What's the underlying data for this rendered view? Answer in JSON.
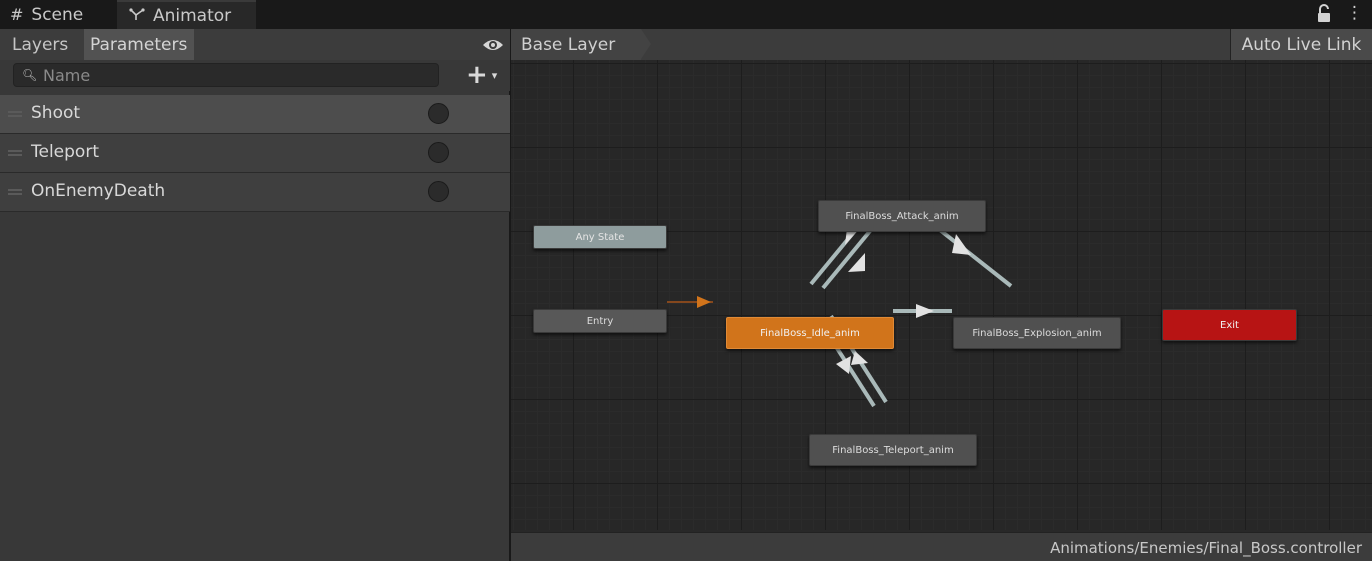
{
  "tabs": {
    "scene": {
      "icon": "grid-icon",
      "label": "Scene"
    },
    "animator": {
      "icon": "animator-icon",
      "label": "Animator"
    }
  },
  "window_menu": {
    "lock": "lock-icon",
    "menu_glyph": "⋮"
  },
  "left_panel": {
    "tabs": {
      "layers": "Layers",
      "parameters": "Parameters"
    },
    "visibility_icon": "eye-icon",
    "search": {
      "placeholder": "Name",
      "value": ""
    },
    "add_button": {
      "plus": "+",
      "caret": "▾"
    },
    "parameters": [
      {
        "name": "Shoot",
        "type": "trigger",
        "selected": true
      },
      {
        "name": "Teleport",
        "type": "trigger",
        "selected": false
      },
      {
        "name": "OnEnemyDeath",
        "type": "trigger",
        "selected": false
      }
    ]
  },
  "graph": {
    "breadcrumb": "Base Layer",
    "auto_live_link": "Auto Live Link",
    "states": {
      "any_state": "Any State",
      "entry": "Entry",
      "exit": "Exit",
      "idle": "FinalBoss_Idle_anim",
      "attack": "FinalBoss_Attack_anim",
      "explosion": "FinalBoss_Explosion_anim",
      "teleport": "FinalBoss_Teleport_anim"
    },
    "transitions": [
      {
        "from": "entry",
        "to": "idle",
        "color": "#c26a1a"
      },
      {
        "from": "idle",
        "to": "attack",
        "color": "#b5c5c5"
      },
      {
        "from": "attack",
        "to": "idle",
        "color": "#b5c5c5"
      },
      {
        "from": "attack",
        "to": "explosion",
        "color": "#b5c5c5"
      },
      {
        "from": "idle",
        "to": "explosion",
        "color": "#b5c5c5"
      },
      {
        "from": "idle",
        "to": "teleport",
        "color": "#b5c5c5"
      },
      {
        "from": "teleport",
        "to": "idle",
        "color": "#b5c5c5"
      }
    ],
    "status_path": "Animations/Enemies/Final_Boss.controller"
  },
  "colors": {
    "default_state": "#505050",
    "default_state_fill": "#f36d1b",
    "any_state_fill": "#8e9c9d",
    "exit_fill": "#b71414",
    "entry_fill": "#585858"
  }
}
